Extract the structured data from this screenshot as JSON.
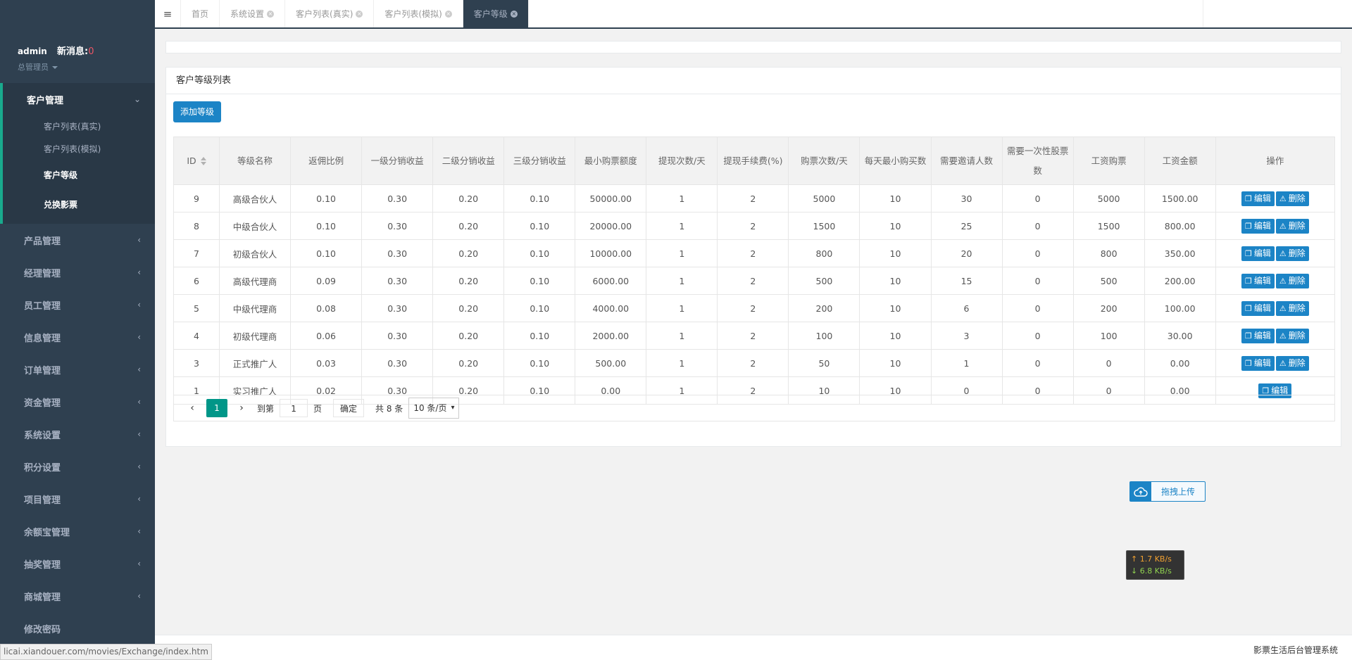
{
  "profile": {
    "username": "admin",
    "msg_label": "新消息:",
    "msg_count": "0",
    "role": "总管理员"
  },
  "sidebar": {
    "active_group": "客户管理",
    "sub_items": [
      "客户列表(真实)",
      "客户列表(模拟)",
      "客户等级",
      "兑换影票"
    ],
    "items": [
      "产品管理",
      "经理管理",
      "员工管理",
      "信息管理",
      "订单管理",
      "资金管理",
      "系统设置",
      "积分设置",
      "项目管理",
      "余额宝管理",
      "抽奖管理",
      "商城管理",
      "修改密码"
    ]
  },
  "tabs": [
    "首页",
    "系统设置",
    "客户列表(真实)",
    "客户列表(模拟)",
    "客户等级"
  ],
  "panel": {
    "title": "客户等级列表",
    "add_button": "添加等级"
  },
  "table": {
    "headers": [
      "ID",
      "等级名称",
      "返佣比例",
      "一级分销收益",
      "二级分销收益",
      "三级分销收益",
      "最小购票额度",
      "提现次数/天",
      "提现手续费(%)",
      "购票次数/天",
      "每天最小购买数",
      "需要邀请人数",
      "需要一次性股票数",
      "工资购票",
      "工资金额",
      "操作"
    ],
    "edit_label": "编辑",
    "delete_label": "删除",
    "rows": [
      [
        "9",
        "高级合伙人",
        "0.10",
        "0.30",
        "0.20",
        "0.10",
        "50000.00",
        "1",
        "2",
        "5000",
        "10",
        "30",
        "0",
        "5000",
        "1500.00"
      ],
      [
        "8",
        "中级合伙人",
        "0.10",
        "0.30",
        "0.20",
        "0.10",
        "20000.00",
        "1",
        "2",
        "1500",
        "10",
        "25",
        "0",
        "1500",
        "800.00"
      ],
      [
        "7",
        "初级合伙人",
        "0.10",
        "0.30",
        "0.20",
        "0.10",
        "10000.00",
        "1",
        "2",
        "800",
        "10",
        "20",
        "0",
        "800",
        "350.00"
      ],
      [
        "6",
        "高级代理商",
        "0.09",
        "0.30",
        "0.20",
        "0.10",
        "6000.00",
        "1",
        "2",
        "500",
        "10",
        "15",
        "0",
        "500",
        "200.00"
      ],
      [
        "5",
        "中级代理商",
        "0.08",
        "0.30",
        "0.20",
        "0.10",
        "4000.00",
        "1",
        "2",
        "200",
        "10",
        "6",
        "0",
        "200",
        "100.00"
      ],
      [
        "4",
        "初级代理商",
        "0.06",
        "0.30",
        "0.20",
        "0.10",
        "2000.00",
        "1",
        "2",
        "100",
        "10",
        "3",
        "0",
        "100",
        "30.00"
      ],
      [
        "3",
        "正式推广人",
        "0.03",
        "0.30",
        "0.20",
        "0.10",
        "500.00",
        "1",
        "2",
        "50",
        "10",
        "1",
        "0",
        "0",
        "0.00"
      ],
      [
        "1",
        "实习推广人",
        "0.02",
        "0.30",
        "0.20",
        "0.10",
        "0.00",
        "1",
        "2",
        "10",
        "10",
        "0",
        "0",
        "0",
        "0.00"
      ]
    ]
  },
  "pager": {
    "current": "1",
    "goto_label": "到第",
    "page_input": "1",
    "page_label": "页",
    "ok_label": "确定",
    "total": "共 8 条",
    "per_page": "10 条/页"
  },
  "upload": {
    "label": "拖拽上传"
  },
  "netspeed": {
    "up": "↑ 1.7 KB/s",
    "down": "↓ 6.8 KB/s"
  },
  "footer": {
    "system_name": "影票生活后台管理系统",
    "status_url": "licai.xiandouer.com/movies/Exchange/index.htm"
  },
  "colors": {
    "sidebar_bg": "#2f4050",
    "primary": "#1c84c6",
    "pager_active": "#009688",
    "msg_count": "#ed5565"
  }
}
